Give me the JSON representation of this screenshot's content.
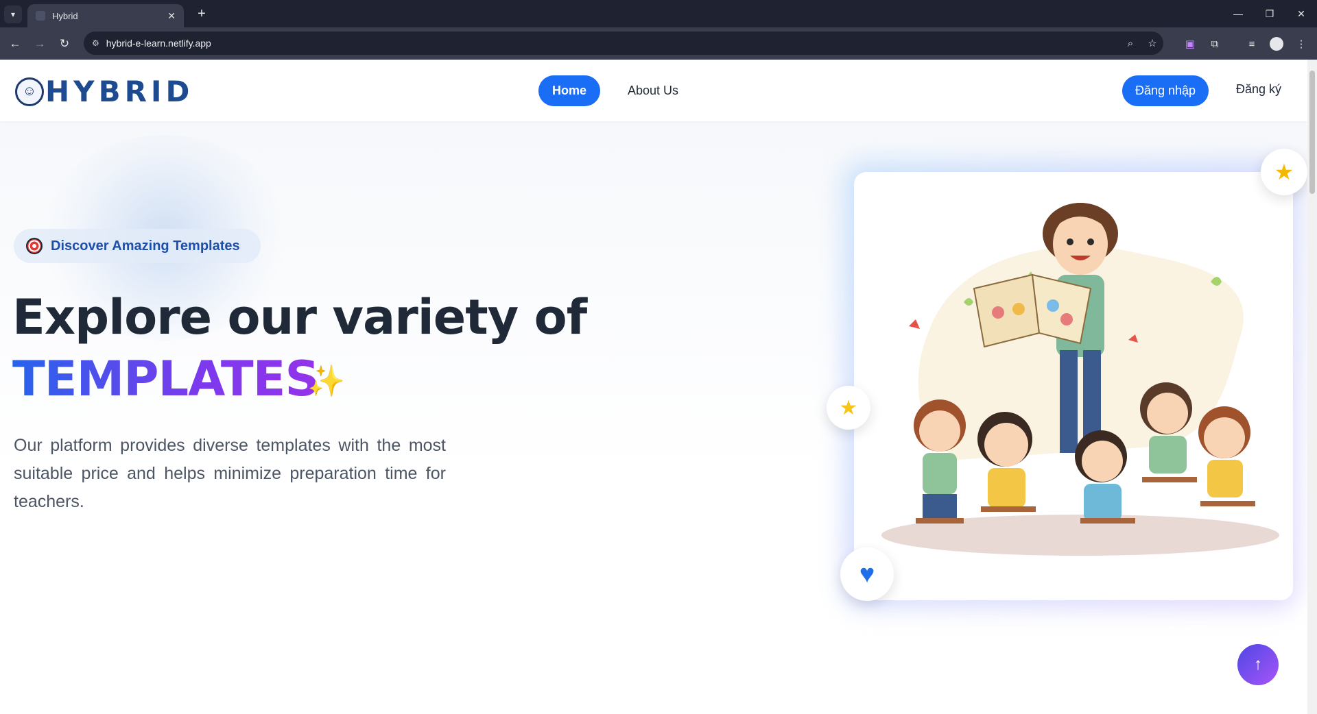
{
  "browser": {
    "tab_title": "Hybrid",
    "tab_close": "✕",
    "new_tab": "+",
    "url": "hybrid-e-learn.netlify.app",
    "window": {
      "minimize": "—",
      "restore": "❐",
      "close": "✕"
    }
  },
  "site": {
    "logo_text": "HYBRID",
    "nav": {
      "home": "Home",
      "about": "About Us"
    },
    "auth": {
      "login": "Đăng nhập",
      "register": "Đăng ký"
    }
  },
  "hero": {
    "badge": "Discover Amazing Templates",
    "title_line1": "Explore our variety of",
    "title_line2": "TEMPLATES",
    "description": "Our platform provides diverse templates with the most suitable price and helps minimize preparation time for teachers."
  },
  "icons": {
    "star": "★",
    "heart": "♥",
    "sparkle": "✨",
    "arrow_up": "↑"
  },
  "colors": {
    "primary": "#1a6ef5",
    "heading": "#1f2937",
    "gradient_start": "#2563eb",
    "gradient_end": "#9333ea",
    "badge_text": "#1e4fa8"
  }
}
